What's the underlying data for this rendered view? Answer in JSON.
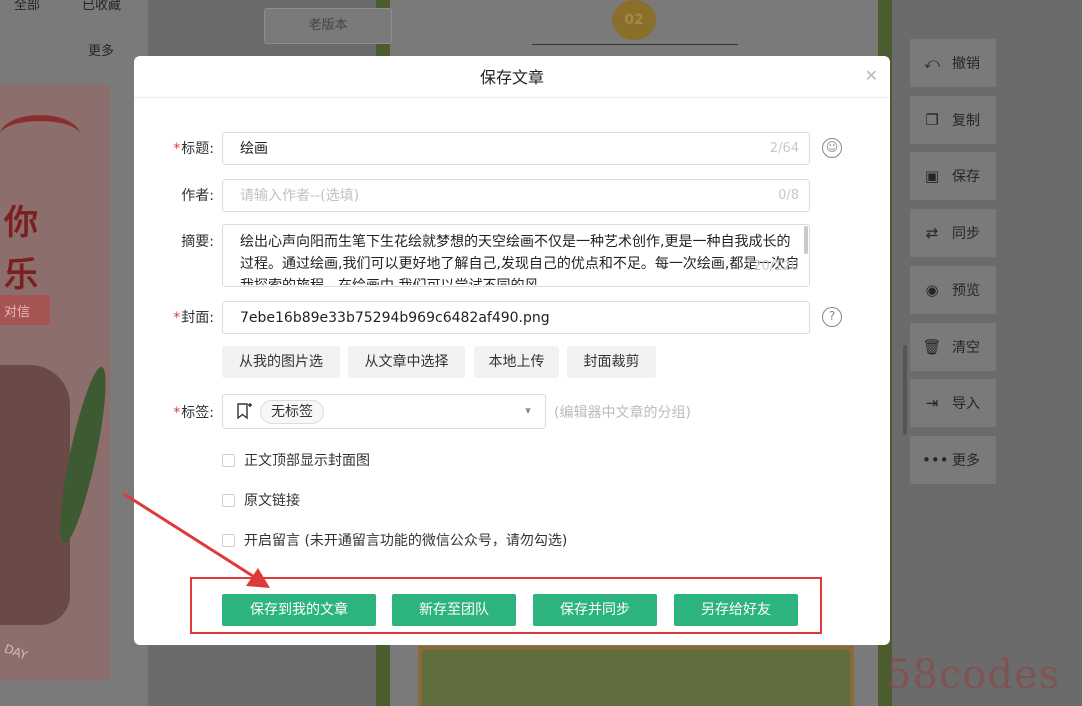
{
  "background": {
    "left_tab_all": "全部",
    "left_tab_fav": "已收藏",
    "left_more": "更多",
    "old_version_button": "老版本",
    "sun_badge": "02",
    "poster_text_line1": "你",
    "poster_text_line2": "乐",
    "poster_tag": "对信",
    "poster_day": "DAY",
    "watermark": "58codes"
  },
  "right_toolbar": {
    "items": [
      {
        "icon": "undo-icon",
        "label": "撤销"
      },
      {
        "icon": "copy-icon",
        "label": "复制"
      },
      {
        "icon": "save-icon",
        "label": "保存"
      },
      {
        "icon": "sync-icon",
        "label": "同步"
      },
      {
        "icon": "eye-icon",
        "label": "预览"
      },
      {
        "icon": "trash-icon",
        "label": "清空"
      },
      {
        "icon": "import-icon",
        "label": "导入"
      },
      {
        "icon": "more-icon",
        "label": "更多"
      }
    ]
  },
  "dialog": {
    "title": "保存文章",
    "title_label": "标题:",
    "title_value": "绘画",
    "title_count": "2/64",
    "author_label": "作者:",
    "author_placeholder": "请输入作者--(选填)",
    "author_count": "0/8",
    "abstract_label": "摘要:",
    "abstract_value": "绘出心声向阳而生笔下生花绘就梦想的天空绘画不仅是一种艺术创作,更是一种自我成长的过程。通过绘画,我们可以更好地了解自己,发现自己的优点和不足。每一次绘画,都是一次自我探索的旅程。在绘画中,我们可以尝试不同的风",
    "abstract_count": "120/120",
    "cover_label": "封面:",
    "cover_value": "7ebe16b89e33b75294b969c6482af490.png",
    "cover_buttons": [
      "从我的图片选",
      "从文章中选择",
      "本地上传",
      "封面裁剪"
    ],
    "tag_label": "标签:",
    "tag_value": "无标签",
    "tag_hint": "(编辑器中文章的分组)",
    "checkboxes": [
      {
        "label": "正文顶部显示封面图",
        "checked": false
      },
      {
        "label": "原文链接",
        "checked": false
      },
      {
        "label": "开启留言 (未开通留言功能的微信公众号，请勿勾选)",
        "checked": false
      }
    ],
    "actions": [
      "保存到我的文章",
      "新存至团队",
      "保存并同步",
      "另存给好友"
    ]
  },
  "colors": {
    "primary_green": "#2db37d",
    "highlight_red": "#e0393a",
    "required_star": "#e0393a"
  }
}
